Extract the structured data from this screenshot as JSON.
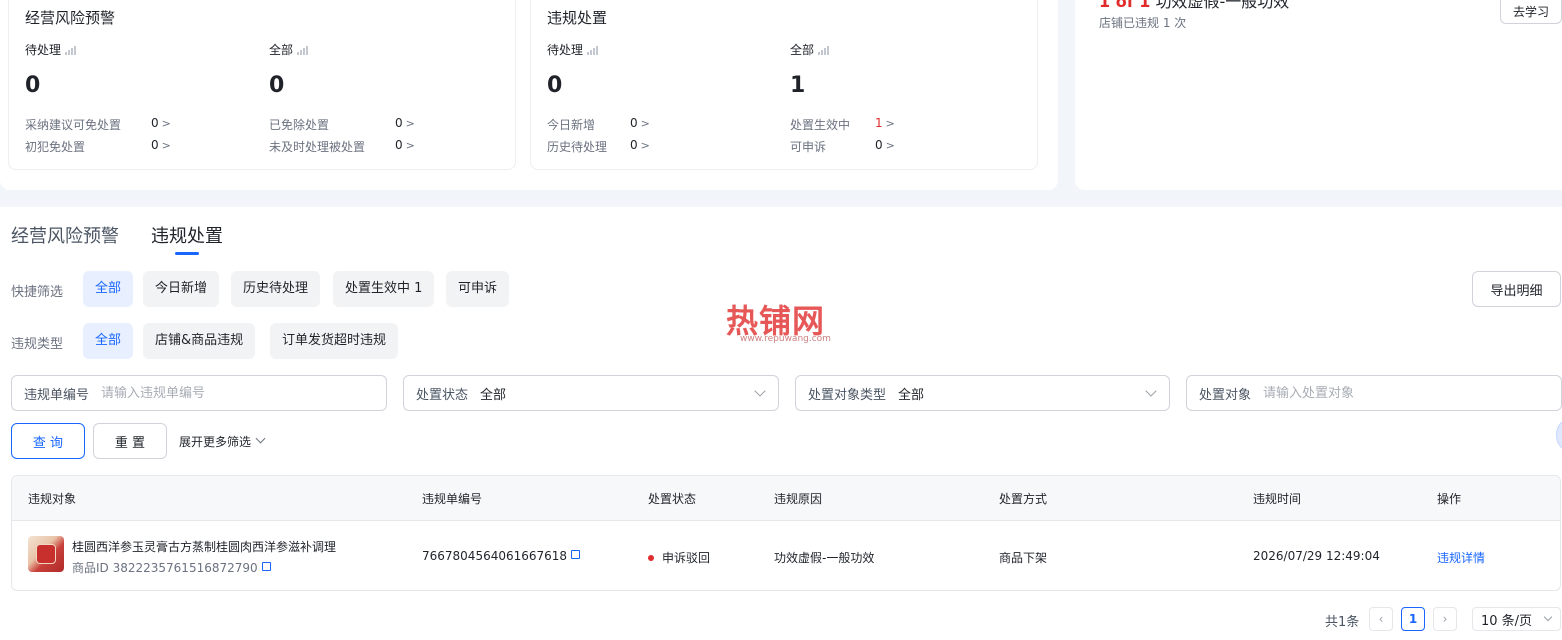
{
  "cards": {
    "risk": {
      "title": "经营风险预警",
      "pending_label": "待处理",
      "pending_value": "0",
      "all_label": "全部",
      "all_value": "0",
      "rows": [
        {
          "label": "采纳建议可免处置",
          "value": "0"
        },
        {
          "label": "初犯免处置",
          "value": "0"
        },
        {
          "label": "已免除处置",
          "value": "0"
        },
        {
          "label": "未及时处理被处置",
          "value": "0"
        }
      ]
    },
    "violation": {
      "title": "违规处置",
      "pending_label": "待处理",
      "pending_value": "0",
      "all_label": "全部",
      "all_value": "1",
      "rows": [
        {
          "label": "今日新增",
          "value": "0"
        },
        {
          "label": "历史待处理",
          "value": "0"
        },
        {
          "label": "处置生效中",
          "value": "1"
        },
        {
          "label": "可申诉",
          "value": "0"
        }
      ]
    },
    "right": {
      "line_partial": "功效虚假-一般功效",
      "count_text": "店铺已违规 1 次",
      "learn_button": "去学习"
    }
  },
  "tabs": [
    {
      "label": "经营风险预警"
    },
    {
      "label": "违规处置"
    }
  ],
  "filters": {
    "quick_label": "快捷筛选",
    "quick_chips": [
      "全部",
      "今日新增",
      "历史待处理",
      "处置生效中 1",
      "可申诉"
    ],
    "type_label": "违规类型",
    "type_chips": [
      "全部",
      "店铺&商品违规",
      "订单发货超时违规"
    ],
    "export_button": "导出明细",
    "fields": {
      "violation_no_label": "违规单编号",
      "violation_no_placeholder": "请输入违规单编号",
      "status_label": "处置状态",
      "status_value": "全部",
      "object_type_label": "处置对象类型",
      "object_type_value": "全部",
      "object_label": "处置对象",
      "object_placeholder": "请输入处置对象"
    },
    "query_button": "查 询",
    "reset_button": "重 置",
    "expand_label": "展开更多筛选"
  },
  "watermark": {
    "main": "热铺网",
    "url": "www.repuwang.com"
  },
  "table": {
    "headers": [
      "违规对象",
      "违规单编号",
      "处置状态",
      "违规原因",
      "处置方式",
      "违规时间",
      "操作"
    ],
    "rows": [
      {
        "title": "桂圆西洋参玉灵膏古方蒸制桂圆肉西洋参滋补调理",
        "product_id": "商品ID 3822235761516872790",
        "violation_no": "7667804564061667618",
        "status": "申诉驳回",
        "reason": "功效虚假-一般功效",
        "method": "商品下架",
        "time": "2026/07/29 12:49:04",
        "action": "违规详情"
      }
    ]
  },
  "pagination": {
    "total": "共1条",
    "current": "1",
    "page_size": "10 条/页"
  },
  "colors": {
    "accent": "#1966ff",
    "danger": "#e02c2c"
  }
}
